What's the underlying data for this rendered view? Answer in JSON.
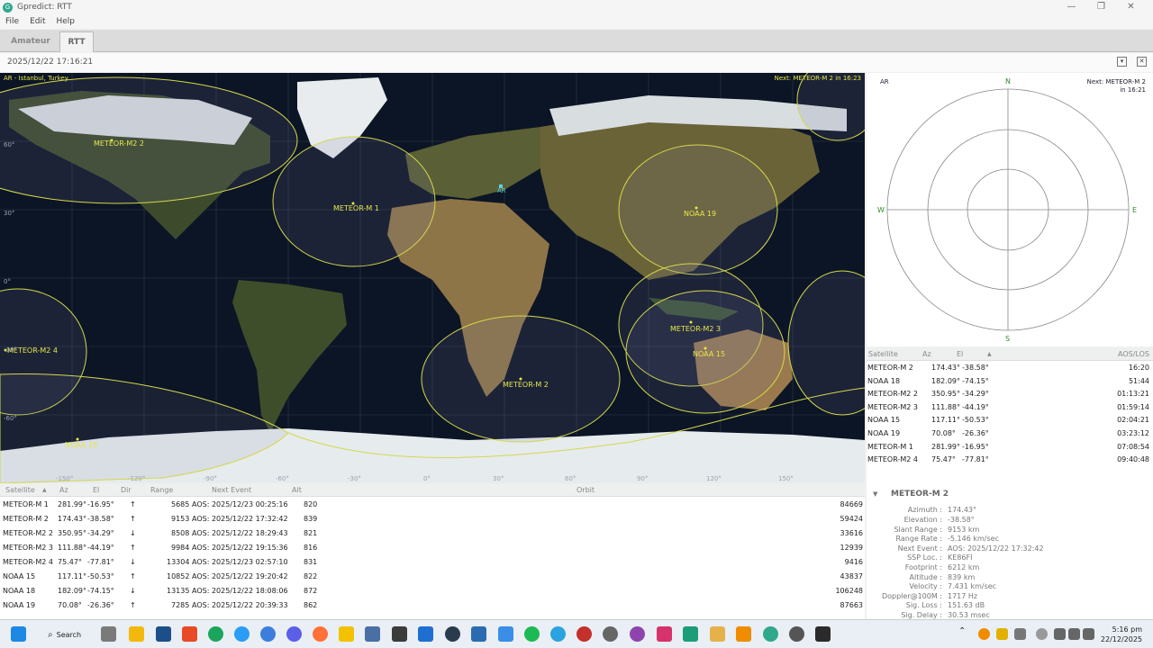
{
  "window": {
    "title": "Gpredict: RTT",
    "app_icon": "G",
    "controls": [
      "—",
      "❐",
      "✕"
    ]
  },
  "menu": [
    "File",
    "Edit",
    "Help"
  ],
  "tabs": [
    {
      "label": "Amateur",
      "active": false
    },
    {
      "label": "RTT",
      "active": true
    }
  ],
  "timestamp": "2025/12/22 17:16:21",
  "map": {
    "qth_label": "AR - Istanbul, Turkey",
    "next_label": "Next: METEOR-M 2 in 16:23",
    "station_marker": "AR",
    "lat_labels": [
      "60°",
      "30°",
      "0°",
      "-30°",
      "-60°"
    ],
    "lon_labels": [
      "-150°",
      "-120°",
      "-90°",
      "-60°",
      "-30°",
      "0°",
      "30°",
      "60°",
      "90°",
      "120°",
      "150°"
    ],
    "satellites": [
      "METEOR-M2 2",
      "METEOR-M 1",
      "NOAA 19",
      "METEOR-M2 3",
      "NOAA 15",
      "METEOR-M2 4",
      "METEOR-M 2",
      "NOAA 18"
    ]
  },
  "polar": {
    "qth": "AR",
    "next_line1": "Next: METEOR-M 2",
    "next_line2": "in 16:21",
    "n": "N",
    "s": "S",
    "e": "E",
    "w": "W"
  },
  "side_table": {
    "headers": {
      "satellite": "Satellite",
      "az": "Az",
      "el": "El",
      "sort": "▲",
      "aos": "AOS/LOS"
    },
    "rows": [
      {
        "sat": "METEOR-M 2",
        "az": "174.43°",
        "el": "-38.58°",
        "aos": "16:20"
      },
      {
        "sat": "NOAA 18",
        "az": "182.09°",
        "el": "-74.15°",
        "aos": "51:44"
      },
      {
        "sat": "METEOR-M2 2",
        "az": "350.95°",
        "el": "-34.29°",
        "aos": "01:13:21"
      },
      {
        "sat": "METEOR-M2 3",
        "az": "111.88°",
        "el": "-44.19°",
        "aos": "01:59:14"
      },
      {
        "sat": "NOAA 15",
        "az": "117.11°",
        "el": "-50.53°",
        "aos": "02:04:21"
      },
      {
        "sat": "NOAA 19",
        "az": "70.08°",
        "el": "-26.36°",
        "aos": "03:23:12"
      },
      {
        "sat": "METEOR-M 1",
        "az": "281.99°",
        "el": "-16.95°",
        "aos": "07:08:54"
      },
      {
        "sat": "METEOR-M2 4",
        "az": "75.47°",
        "el": "-77.81°",
        "aos": "09:40:48"
      }
    ]
  },
  "bottom_table": {
    "headers": {
      "satellite": "Satellite",
      "sort": "▲",
      "az": "Az",
      "el": "El",
      "dir": "Dir",
      "range": "Range",
      "next": "Next Event",
      "alt": "Alt",
      "orbit": "Orbit"
    },
    "rows": [
      {
        "sat": "METEOR-M 1",
        "az": "281.99°",
        "el": "-16.95°",
        "dir": "↑",
        "range": "5685",
        "next": "AOS: 2025/12/23 00:25:16",
        "alt": "820",
        "orbit": "84669"
      },
      {
        "sat": "METEOR-M 2",
        "az": "174.43°",
        "el": "-38.58°",
        "dir": "↑",
        "range": "9153",
        "next": "AOS: 2025/12/22 17:32:42",
        "alt": "839",
        "orbit": "59424"
      },
      {
        "sat": "METEOR-M2 2",
        "az": "350.95°",
        "el": "-34.29°",
        "dir": "↓",
        "range": "8508",
        "next": "AOS: 2025/12/22 18:29:43",
        "alt": "821",
        "orbit": "33616"
      },
      {
        "sat": "METEOR-M2 3",
        "az": "111.88°",
        "el": "-44.19°",
        "dir": "↑",
        "range": "9984",
        "next": "AOS: 2025/12/22 19:15:36",
        "alt": "816",
        "orbit": "12939"
      },
      {
        "sat": "METEOR-M2 4",
        "az": "75.47°",
        "el": "-77.81°",
        "dir": "↓",
        "range": "13304",
        "next": "AOS: 2025/12/23 02:57:10",
        "alt": "831",
        "orbit": "9416"
      },
      {
        "sat": "NOAA 15",
        "az": "117.11°",
        "el": "-50.53°",
        "dir": "↑",
        "range": "10852",
        "next": "AOS: 2025/12/22 19:20:42",
        "alt": "822",
        "orbit": "43837"
      },
      {
        "sat": "NOAA 18",
        "az": "182.09°",
        "el": "-74.15°",
        "dir": "↓",
        "range": "13135",
        "next": "AOS: 2025/12/22 18:08:06",
        "alt": "872",
        "orbit": "106248"
      },
      {
        "sat": "NOAA 19",
        "az": "70.08°",
        "el": "-26.36°",
        "dir": "↑",
        "range": "7285",
        "next": "AOS: 2025/12/22 20:39:33",
        "alt": "862",
        "orbit": "87663"
      }
    ]
  },
  "details": {
    "toggle": "▼",
    "name": "METEOR-M 2",
    "items": [
      {
        "label": "Azimuth :",
        "value": "174.43°"
      },
      {
        "label": "Elevation :",
        "value": "-38.58°"
      },
      {
        "label": "Slant Range :",
        "value": "9153 km"
      },
      {
        "label": "Range Rate :",
        "value": "-5.146 km/sec"
      },
      {
        "label": "Next Event :",
        "value": "AOS: 2025/12/22 17:32:42"
      },
      {
        "label": "SSP Loc. :",
        "value": "KE86FI"
      },
      {
        "label": "Footprint :",
        "value": "6212 km"
      },
      {
        "label": "Altitude :",
        "value": "839 km"
      },
      {
        "label": "Velocity :",
        "value": "7.431 km/sec"
      },
      {
        "label": "Doppler@100M :",
        "value": "1717 Hz"
      },
      {
        "label": "Sig. Loss :",
        "value": "151.63 dB"
      },
      {
        "label": "Sig. Delay :",
        "value": "30.53 msec"
      }
    ]
  },
  "taskbar": {
    "search_label": "Search",
    "time": "5:16 pm",
    "date": "22/12/2025",
    "tray_icons": [
      "chevron-up-icon",
      "search-app-icon",
      "onedrive-icon",
      "network-icon",
      "volume-icon",
      "battery-icon"
    ]
  }
}
